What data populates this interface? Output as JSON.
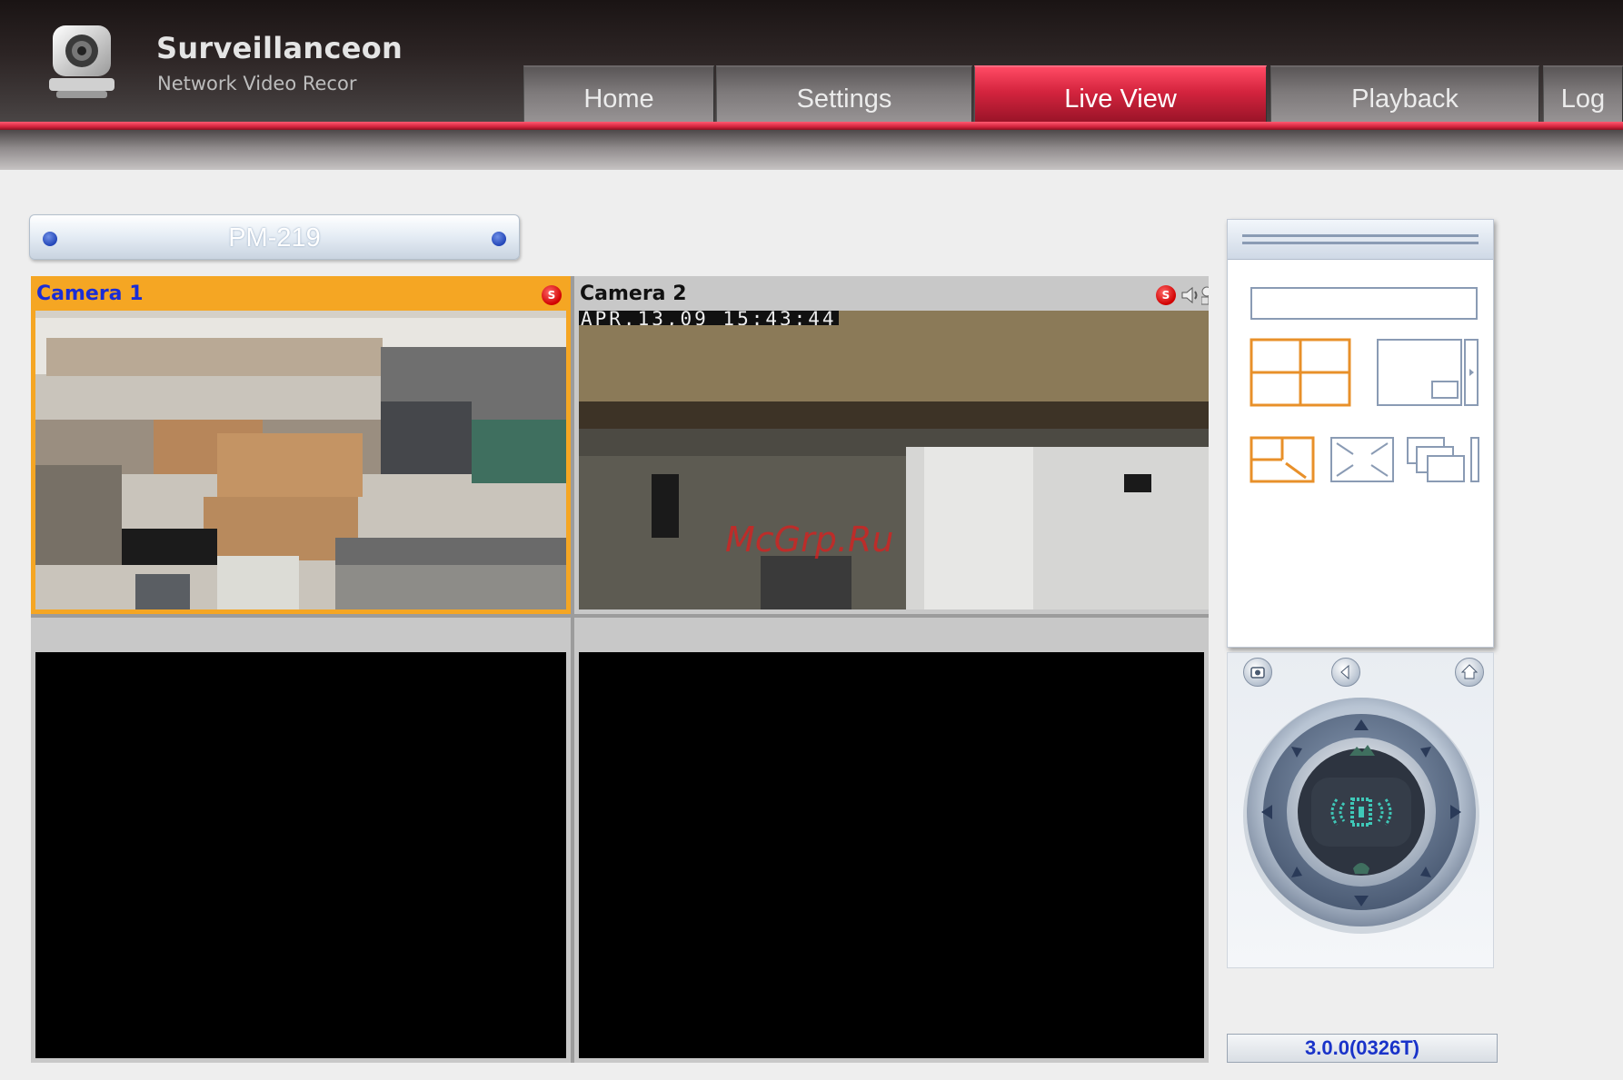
{
  "app": {
    "brand_title": "Surveillanceon",
    "brand_subtitle": "Network Video Recor"
  },
  "nav": {
    "tabs": [
      {
        "label": "Home",
        "active": false
      },
      {
        "label": "Settings",
        "active": false
      },
      {
        "label": "Live View",
        "active": true
      },
      {
        "label": "Playback",
        "active": false
      },
      {
        "label": "Log",
        "active": false
      }
    ]
  },
  "device": {
    "name": "PM-219"
  },
  "cameras": [
    {
      "title": "Camera 1",
      "selected": true,
      "recording": true,
      "rec_badge": "S"
    },
    {
      "title": "Camera 2",
      "selected": false,
      "recording": true,
      "rec_badge": "S",
      "osd_timestamp": "APR.13,09 15:43:44"
    },
    {
      "title": "",
      "selected": false,
      "recording": false
    },
    {
      "title": "",
      "selected": false,
      "recording": false
    }
  ],
  "watermark": "McGrp.Ru",
  "layout_panel": {
    "options": [
      "quad-view",
      "single-view-with-strip",
      "custom-resize-view",
      "fullscreen-view",
      "multi-window-view"
    ]
  },
  "ptz": {
    "buttons": [
      "snapshot-icon",
      "back-icon",
      "home-icon"
    ]
  },
  "version": "3.0.0(0326T)",
  "colors": {
    "accent_red": "#d4243e",
    "selected_orange": "#f5a623",
    "camera1_title": "#1a2dd6",
    "version_text": "#1933c9"
  }
}
